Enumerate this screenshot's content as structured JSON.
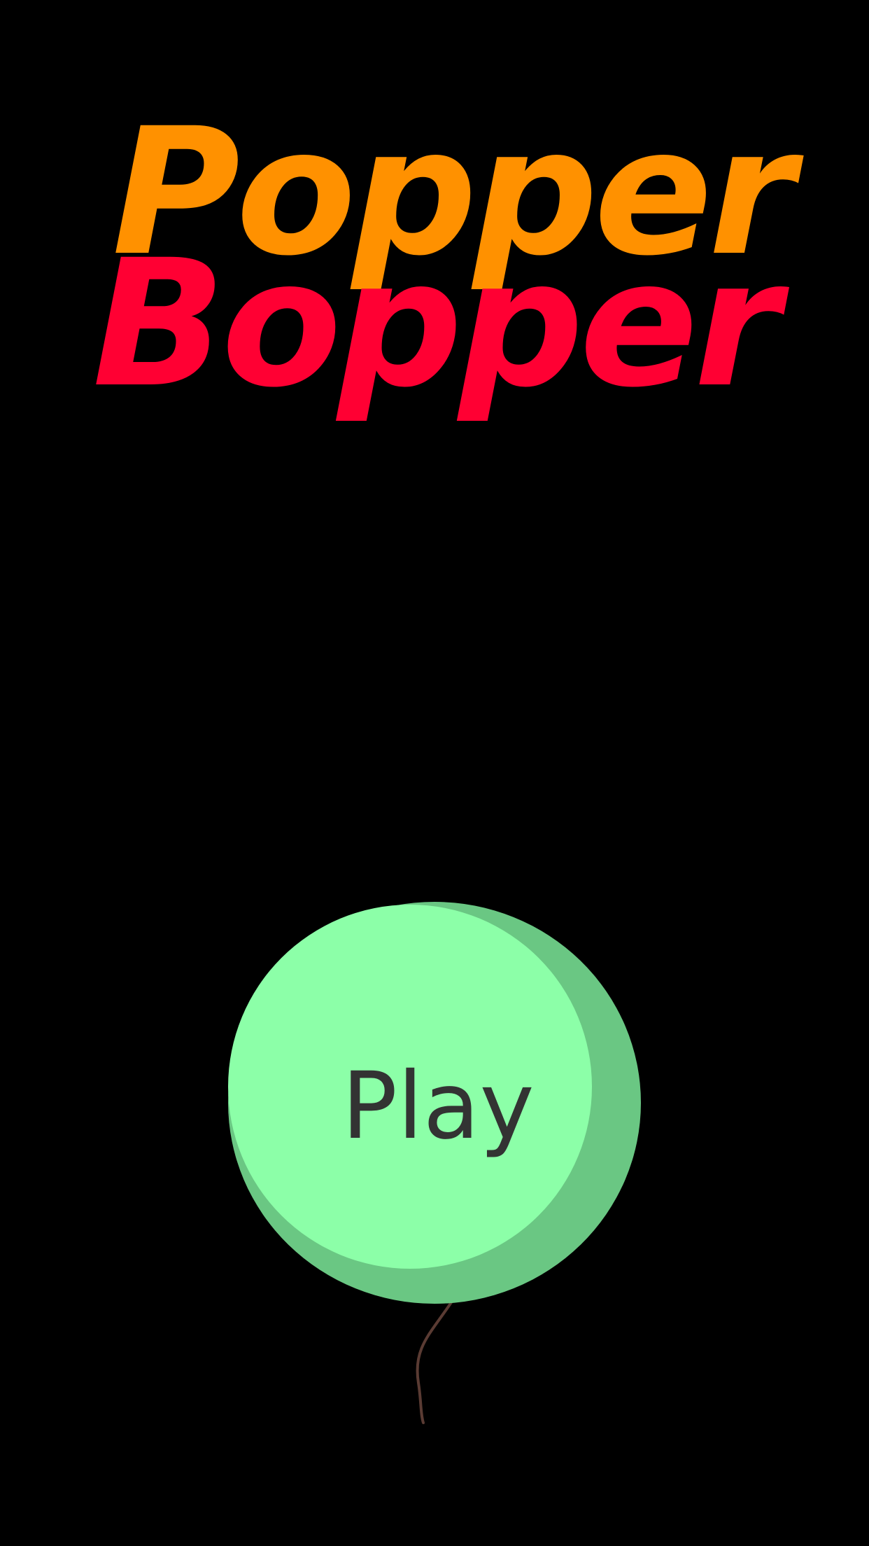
{
  "title": {
    "line1": "Popper",
    "line2": "Bopper"
  },
  "play_button": {
    "label": "Play"
  },
  "colors": {
    "background": "#000000",
    "title_line1": "#ff9100",
    "title_line2": "#ff0033",
    "balloon": "#8cffa8",
    "balloon_shade": "#6ac783",
    "balloon_string": "#5a3b33",
    "label": "#333333"
  },
  "icons": {
    "play_button": "balloon-icon"
  }
}
